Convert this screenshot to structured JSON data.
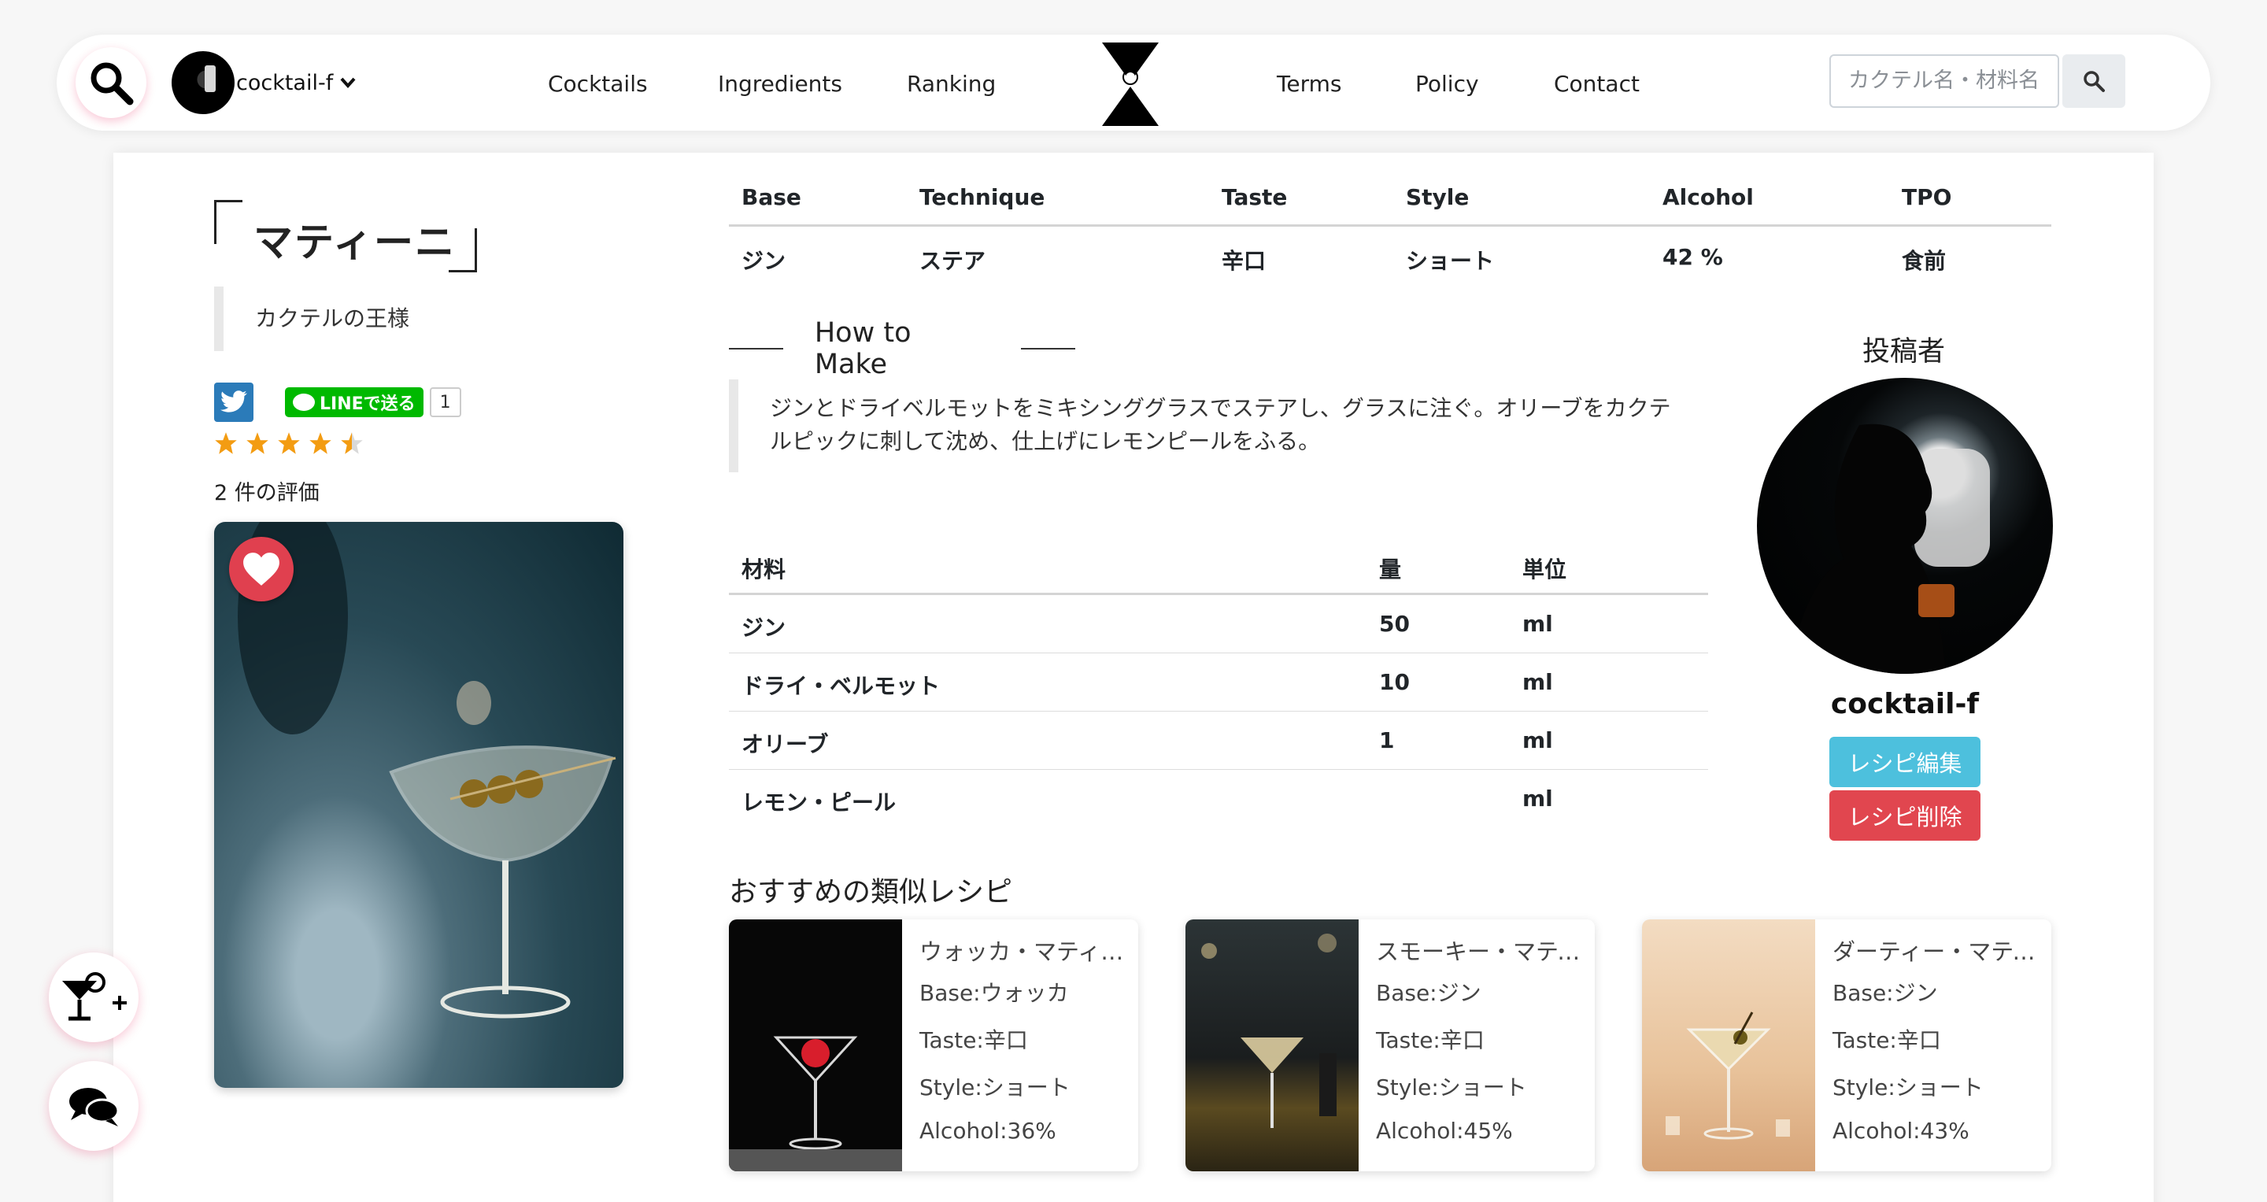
{
  "nav": {
    "user_name": "cocktail-f",
    "links": [
      "Cocktails",
      "Ingredients",
      "Ranking",
      "Terms",
      "Policy",
      "Contact"
    ],
    "search_placeholder": "カクテル名・材料名"
  },
  "recipe": {
    "title": "マティーニ",
    "subtitle": "カクテルの王様",
    "line_button": "LINEで送る",
    "line_count": "1",
    "rating": 4.5,
    "rating_count": "2 件の評価"
  },
  "attributes": {
    "headers": [
      "Base",
      "Technique",
      "Taste",
      "Style",
      "Alcohol",
      "TPO"
    ],
    "values": [
      "ジン",
      "ステア",
      "辛口",
      "ショート",
      "42 %",
      "食前"
    ]
  },
  "how_to_make": {
    "heading": "How to Make",
    "text": "ジンとドライベルモットをミキシンググラスでステアし、グラスに注ぐ。オリーブをカクテルピックに刺して沈め、仕上げにレモンピールをふる。"
  },
  "ingredients": {
    "headers": [
      "材料",
      "量",
      "単位"
    ],
    "rows": [
      [
        "ジン",
        "50",
        "ml"
      ],
      [
        "ドライ・ベルモット",
        "10",
        "ml"
      ],
      [
        "オリーブ",
        "1",
        "ml"
      ],
      [
        "レモン・ピール",
        "",
        "ml"
      ]
    ]
  },
  "author": {
    "label": "投稿者",
    "name": "cocktail-f",
    "edit_button": "レシピ編集",
    "delete_button": "レシピ削除"
  },
  "similar": {
    "title": "おすすめの類似レシピ",
    "items": [
      {
        "name": "ウォッカ・マティーニ",
        "base": "Base:ウォッカ",
        "taste": "Taste:辛口",
        "style": "Style:ショート",
        "alcohol": "Alcohol:36%"
      },
      {
        "name": "スモーキー・マティ...",
        "base": "Base:ジン",
        "taste": "Taste:辛口",
        "style": "Style:ショート",
        "alcohol": "Alcohol:45%"
      },
      {
        "name": "ダーティー・マティ...",
        "base": "Base:ジン",
        "taste": "Taste:辛口",
        "style": "Style:ショート",
        "alcohol": "Alcohol:43%"
      }
    ]
  },
  "colors": {
    "twitter": "#2b7bb9",
    "line": "#00b900",
    "edit": "#4dc0dd",
    "delete": "#e1464f",
    "favorite": "#e0404f",
    "star": "#f39c12"
  }
}
